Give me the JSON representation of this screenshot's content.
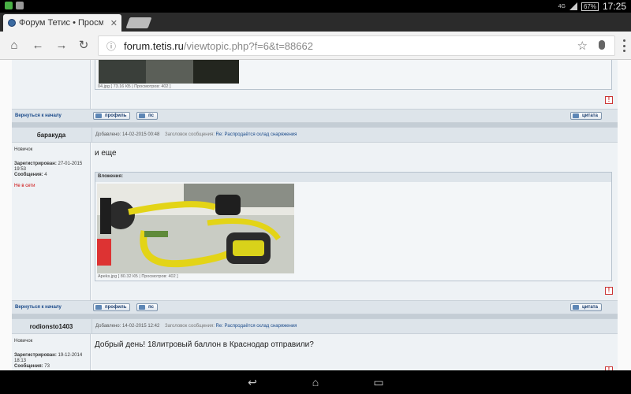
{
  "statusbar": {
    "network": "4G",
    "battery": "67%",
    "time": "17:25"
  },
  "tab": {
    "title": "Форум Тетис • Просмотр те",
    "close": "✕"
  },
  "toolbar": {
    "url_host": "forum.tetis.ru",
    "url_path": "/viewtopic.php?f=6&t=88662"
  },
  "forum": {
    "first_post_tail": {
      "caption": "04.jpg [ 73.16 КБ | Просмотров: 402 ]",
      "back_to_top": "Вернуться к началу",
      "btn_profile": "профиль",
      "btn_pm": "пс",
      "btn_quote": "цитата"
    },
    "post2": {
      "author": "баракуда",
      "rank": "Новичок",
      "registered_label": "Зарегистрирован:",
      "registered": "27-01-2015 19:53",
      "posts_label": "Сообщения:",
      "posts": "4",
      "status": "Не в сети",
      "meta_added": "Добавлено: 14-02-2015 00:48",
      "meta_subject_label": "Заголовок сообщения:",
      "meta_subject": "Re: Распродаётся склад снаряжения",
      "body": "и еще",
      "attachments_label": "Вложения:",
      "caption": "Apeks.jpg [ 80.32 КБ | Просмотров: 402 ]",
      "back_to_top": "Вернуться к началу",
      "btn_profile": "профиль",
      "btn_pm": "пс",
      "btn_quote": "цитата"
    },
    "post3": {
      "author": "rodionsto1403",
      "rank": "Новичок",
      "registered_label": "Зарегистрирован:",
      "registered": "19-12-2014 18:13",
      "posts_label": "Сообщения:",
      "posts": "73",
      "meta_added": "Добавлено: 14-02-2015 12:42",
      "meta_subject_label": "Заголовок сообщения:",
      "meta_subject": "Re: Распродаётся склад снаряжения",
      "body": "Добрый день! 18литровый баллон в Краснодар отправили?"
    }
  }
}
